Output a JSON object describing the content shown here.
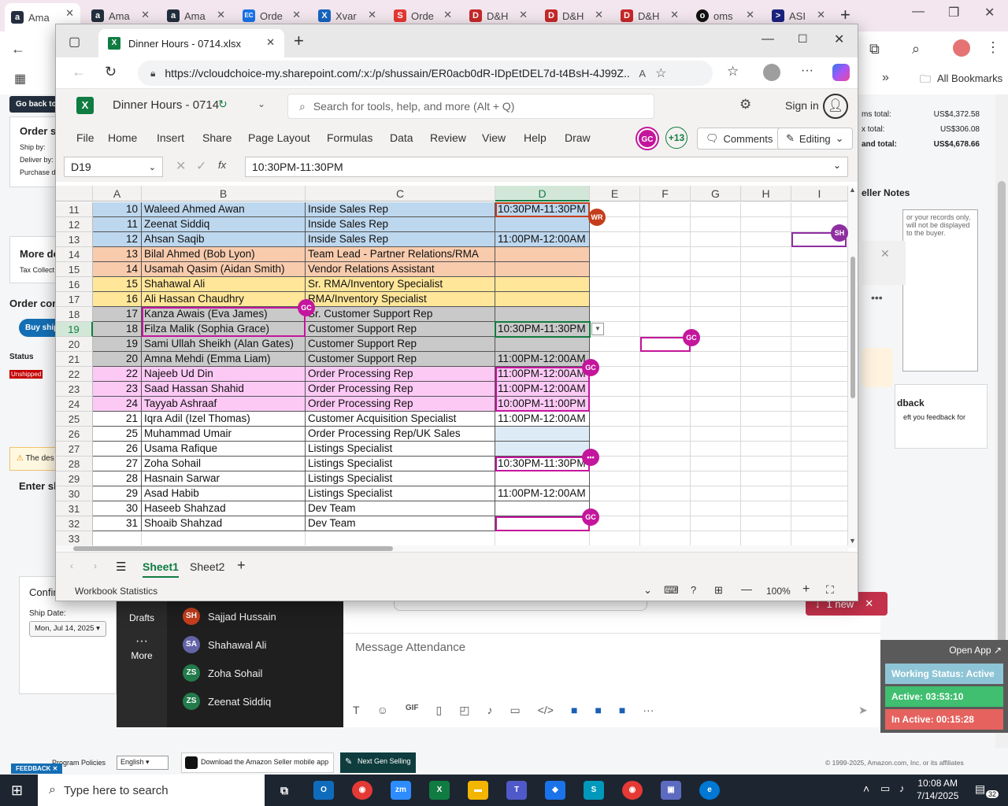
{
  "browser_tabs": [
    {
      "label": "Ama",
      "fav": "a",
      "color": "#232f3e"
    },
    {
      "label": "Ama",
      "fav": "a",
      "color": "#232f3e"
    },
    {
      "label": "Ama",
      "fav": "a",
      "color": "#232f3e"
    },
    {
      "label": "Orde",
      "fav": "EC",
      "color": "#1a73e8"
    },
    {
      "label": "Xvar",
      "fav": "X",
      "color": "#1565c0"
    },
    {
      "label": "Orde",
      "fav": "S",
      "color": "#e53935"
    },
    {
      "label": "D&H",
      "fav": "D",
      "color": "#c62828"
    },
    {
      "label": "D&H",
      "fav": "D",
      "color": "#c62828"
    },
    {
      "label": "D&H",
      "fav": "D",
      "color": "#c62828"
    },
    {
      "label": "oms",
      "fav": "o",
      "color": "#111111"
    },
    {
      "label": "ASI",
      "fav": ">",
      "color": "#1a237e"
    }
  ],
  "bg_browser": {
    "all_bookmarks": "All Bookmarks"
  },
  "seller": {
    "go_back": "Go back to",
    "order_summary": "Order su",
    "ship_by": "Ship by:",
    "deliver_by": "Deliver by:",
    "purchase": "Purchase d",
    "more_details": "More de",
    "tax_collect": "Tax Collect",
    "order_contents": "Order cont",
    "buy_shipping": "Buy shipp",
    "status_label": "Status",
    "status_value": "Unshipped",
    "warning": "The des",
    "enter_shipping": "Enter sh",
    "confirm": "Confir",
    "ship_date_label": "Ship Date:",
    "ship_date_value": "Mon, Jul 14, 2025",
    "items_total_label": "ms total:",
    "items_total": "US$4,372.58",
    "tax_total_label": "x total:",
    "tax_total": "US$306.08",
    "grand_total_label": "and total:",
    "grand_total": "US$4,678.66",
    "seller_notes": "eller Notes",
    "notes_placeholder": "or your records only, will not be displayed to the buyer.",
    "feedback_title": "dback",
    "feedback_text": "eft you feedback for",
    "footer_program": "Program Policies",
    "footer_lang": "English",
    "footer_app": "Download the Amazon Seller mobile app",
    "footer_next": "Next Gen Selling",
    "footer_copy": "© 1999-2025, Amazon.com, Inc. or its affiliates",
    "feedback_btn": "FEEDBACK"
  },
  "teams": {
    "drafts": "Drafts",
    "more": "More",
    "message_placeholder": "Message Attendance",
    "new_btn": "1 new",
    "people": [
      {
        "initials": "SH",
        "name": "Sajjad Hussain",
        "color": "#c43e1c"
      },
      {
        "initials": "SA",
        "name": "Shahawal Ali",
        "color": "#6264a7"
      },
      {
        "initials": "ZS",
        "name": "Zoha Sohail",
        "color": "#237b4b"
      },
      {
        "initials": "ZS",
        "name": "Zeenat Siddiq",
        "color": "#237b4b"
      }
    ]
  },
  "status_widget": {
    "open_app": "Open App",
    "working": "Working Status: Active",
    "active": "Active: 03:53:10",
    "inactive": "In Active: 00:15:28"
  },
  "excel": {
    "tab_title": "Dinner Hours - 0714.xlsx",
    "url": "https://vcloudchoice-my.sharepoint.com/:x:/p/shussain/ER0acb0dR-IDpEtDEL7d-t4BsH-4J99Z...",
    "file_name": "Dinner Hours - 0714",
    "search_placeholder": "Search for tools, help, and more (Alt + Q)",
    "sign_in": "Sign in",
    "menu": [
      "File",
      "Home",
      "Insert",
      "Share",
      "Page Layout",
      "Formulas",
      "Data",
      "Review",
      "View",
      "Help",
      "Draw"
    ],
    "collab_count": "+13",
    "comments": "Comments",
    "editing": "Editing",
    "name_box": "D19",
    "formula": "10:30PM-11:30PM",
    "fx": "fx",
    "columns": [
      "A",
      "B",
      "C",
      "D",
      "E",
      "F",
      "G",
      "H",
      "I"
    ],
    "rows": [
      {
        "r": "11",
        "a": "10",
        "b": "Waleed Ahmed Awan",
        "c": "Inside Sales Rep",
        "d": "10:30PM-11:30PM",
        "fill": "#bdd7ee"
      },
      {
        "r": "12",
        "a": "11",
        "b": "Zeenat Siddiq",
        "c": "Inside Sales Rep",
        "d": "",
        "fill": "#bdd7ee"
      },
      {
        "r": "13",
        "a": "12",
        "b": "Ahsan Saqib",
        "c": "Inside Sales Rep",
        "d": "11:00PM-12:00AM",
        "fill": "#bdd7ee"
      },
      {
        "r": "14",
        "a": "13",
        "b": "Bilal Ahmed (Bob Lyon)",
        "c": "Team Lead - Partner Relations/RMA",
        "d": "",
        "fill": "#f8cbad"
      },
      {
        "r": "15",
        "a": "14",
        "b": "Usamah Qasim (Aidan Smith)",
        "c": "Vendor Relations Assistant",
        "d": "",
        "fill": "#f8cbad"
      },
      {
        "r": "16",
        "a": "15",
        "b": "Shahawal Ali",
        "c": "Sr. RMA/Inventory Specialist",
        "d": "",
        "fill": "#ffe699"
      },
      {
        "r": "17",
        "a": "16",
        "b": "Ali Hassan Chaudhry",
        "c": "RMA/Inventory Specialist",
        "d": "",
        "fill": "#ffe699"
      },
      {
        "r": "18",
        "a": "17",
        "b": "Kanza Awais (Eva James)",
        "c": "Sr. Customer Support Rep",
        "d": "",
        "fill": "#c9c9c9"
      },
      {
        "r": "19",
        "a": "18",
        "b": "Filza Malik (Sophia Grace)",
        "c": "Customer Support Rep",
        "d": "10:30PM-11:30PM",
        "fill": "#c9c9c9"
      },
      {
        "r": "20",
        "a": "19",
        "b": "Sami Ullah Sheikh (Alan Gates)",
        "c": "Customer Support Rep",
        "d": "",
        "fill": "#c9c9c9"
      },
      {
        "r": "21",
        "a": "20",
        "b": "Amna Mehdi (Emma Liam)",
        "c": "Customer Support Rep",
        "d": "11:00PM-12:00AM",
        "fill": "#c9c9c9"
      },
      {
        "r": "22",
        "a": "22",
        "b": "Najeeb Ud Din",
        "c": "Order Processing Rep",
        "d": "11:00PM-12:00AM",
        "fill": "#fcc9f5"
      },
      {
        "r": "23",
        "a": "23",
        "b": "Saad Hassan Shahid",
        "c": "Order Processing Rep",
        "d": "11:00PM-12:00AM",
        "fill": "#fcc9f5"
      },
      {
        "r": "24",
        "a": "24",
        "b": "Tayyab Ashraaf",
        "c": "Order Processing Rep",
        "d": "10:00PM-11:00PM",
        "fill": "#fcc9f5"
      },
      {
        "r": "25",
        "a": "21",
        "b": "Iqra Adil (Izel Thomas)",
        "c": "Customer Acquisition Specialist",
        "d": "11:00PM-12:00AM",
        "fill": "#ffffff"
      },
      {
        "r": "26",
        "a": "25",
        "b": "Muhammad Umair",
        "c": "Order Processing Rep/UK Sales",
        "d": "",
        "fill": "#ffffff"
      },
      {
        "r": "27",
        "a": "26",
        "b": "Usama Rafique",
        "c": "Listings Specialist",
        "d": "",
        "fill": "#ffffff"
      },
      {
        "r": "28",
        "a": "27",
        "b": "Zoha Sohail",
        "c": "Listings Specialist",
        "d": "10:30PM-11:30PM",
        "fill": "#ffffff"
      },
      {
        "r": "29",
        "a": "28",
        "b": "Hasnain Sarwar",
        "c": "Listings Specialist",
        "d": "",
        "fill": "#ffffff"
      },
      {
        "r": "30",
        "a": "29",
        "b": "Asad Habib",
        "c": "Listings Specialist",
        "d": "11:00PM-12:00AM",
        "fill": "#ffffff"
      },
      {
        "r": "31",
        "a": "30",
        "b": "Haseeb Shahzad",
        "c": "Dev Team",
        "d": "",
        "fill": "#ffffff"
      },
      {
        "r": "32",
        "a": "31",
        "b": "Shoaib Shahzad",
        "c": "Dev Team",
        "d": "",
        "fill": "#ffffff"
      },
      {
        "r": "33",
        "a": "",
        "b": "",
        "c": "",
        "d": "",
        "fill": "#ffffff"
      }
    ],
    "collaborator_tags": [
      {
        "initials": "WR",
        "color": "#c43e1c"
      },
      {
        "initials": "GC",
        "color": "#c4169c"
      },
      {
        "initials": "GC",
        "color": "#c4169c"
      },
      {
        "initials": "GC",
        "color": "#c4169c"
      },
      {
        "initials": "GC",
        "color": "#c4169c"
      },
      {
        "initials": "SH",
        "color": "#8e2ea0"
      },
      {
        "initials": "•••",
        "color": "#c4169c"
      }
    ],
    "sheets": [
      "Sheet1",
      "Sheet2"
    ],
    "workbook_stats": "Workbook Statistics",
    "zoom": "100%"
  },
  "taskbar": {
    "search_placeholder": "Type here to search",
    "time": "10:08 AM",
    "date": "7/14/2025",
    "notif": "32"
  }
}
